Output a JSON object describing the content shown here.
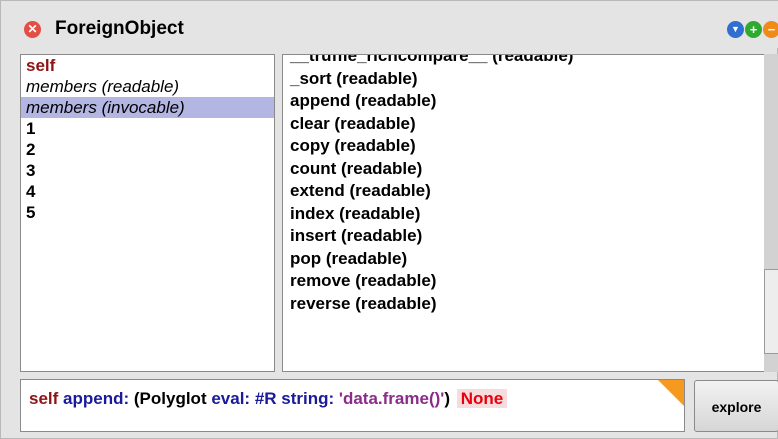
{
  "window": {
    "title": "ForeignObject",
    "close_glyph": "✕",
    "menu_glyph": "▼",
    "expand_glyph": "+",
    "collapse_glyph": "−"
  },
  "fields": {
    "items": [
      {
        "label": "self",
        "style": "self"
      },
      {
        "label": "members (readable)",
        "style": "italic"
      },
      {
        "label": "members (invocable)",
        "style": "italic",
        "selected": true
      },
      {
        "label": "1",
        "style": "num"
      },
      {
        "label": "2",
        "style": "num"
      },
      {
        "label": "3",
        "style": "num"
      },
      {
        "label": "4",
        "style": "num"
      },
      {
        "label": "5",
        "style": "num"
      }
    ]
  },
  "values": {
    "items": [
      "__truffle_richcompare__ (readable)",
      "_sort (readable)",
      "append (readable)",
      "clear (readable)",
      "copy (readable)",
      "count (readable)",
      "extend (readable)",
      "index (readable)",
      "insert (readable)",
      "pop (readable)",
      "remove (readable)",
      "reverse (readable)"
    ]
  },
  "code": {
    "receiver": "self",
    "selector": "append:",
    "open_paren": "(",
    "class_name": "Polyglot",
    "eval_kw": "eval:",
    "lang_symbol": "#R",
    "string_kw": "string:",
    "source_string": "'data.frame()'",
    "close_paren": ")",
    "result": "None"
  },
  "explore": {
    "label": "explore"
  },
  "colors": {
    "selection": "#b3b5e2",
    "self_color": "#8c1414",
    "message_color": "#1a1a9a",
    "string_color": "#8a2c8a",
    "result_color": "#e8000e",
    "flag_color": "#f59a1f"
  }
}
